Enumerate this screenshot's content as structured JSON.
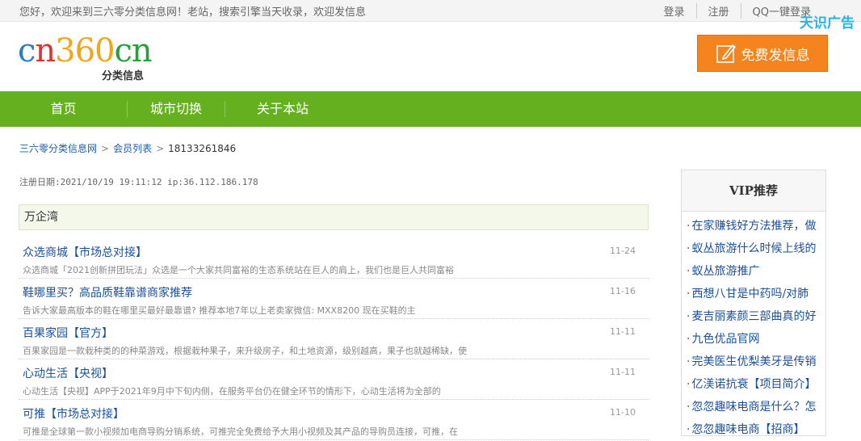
{
  "topbar": {
    "welcome": "您好，欢迎来到三六零分类信息网！老站，搜索引擎当天收录，欢迎发信息",
    "login": "登录",
    "register": "注册",
    "qq_login": "QQ一键登录",
    "ad_tag": "天识广告"
  },
  "logo": {
    "brand_1": "c",
    "brand_2": "n",
    "brand_3": "360",
    "brand_4": "cn",
    "sub": "分类信息"
  },
  "post_button": "免费发信息",
  "nav": [
    "首页",
    "城市切换",
    "关于本站"
  ],
  "breadcrumb": {
    "home": "三六零分类信息网",
    "members": "会员列表",
    "current": "18133261846"
  },
  "reginfo": "注册日期:2021/10/19 19:11:12 ip:36.112.186.178",
  "company": "万企湾",
  "entries": [
    {
      "title": "众选商城【市场总对接】",
      "desc": "众选商城「2021创新拼团玩法」众选是一个大家共同富裕的生态系统站在巨人的肩上，我们也是巨人共同富裕",
      "date": "11-24"
    },
    {
      "title": "鞋哪里买？高品质鞋靠谱商家推荐",
      "desc": "告诉大家最高版本的鞋在哪里买最好最靠谱? 推荐本地7年以上老卖家微信: MXX8200   现在买鞋的主",
      "date": "11-16"
    },
    {
      "title": "百果家园【官方】",
      "desc": "百果家园是一款栽种类的的种菜游戏，根据栽种果子，来升级房子，和土地资源，级别越高，果子也就越稀缺，使",
      "date": "11-11"
    },
    {
      "title": "心动生活【央视】",
      "desc": "心动生活【央视】APP于2021年9月中下旬内侧，在服务平台仍在健全环节的情形下，心动生活将为全部的",
      "date": "11-11"
    },
    {
      "title": "可推【市场总对接】",
      "desc": "可推是全球第一款小视频加电商导购分销系统，可推完全免费给予大用小视频及其产品的导购员连接，可推，在",
      "date": "11-10"
    }
  ],
  "vip": {
    "title": "VIP推荐",
    "items": [
      "在家赚钱好方法推荐，做",
      "蚁丛旅游什么时候上线的",
      "蚁丛旅游推广",
      "西想八甘是中药吗/对肺",
      "麦吉丽素颜三部曲真的好",
      "九色优品官网",
      "完美医生优梨美牙是传销",
      "亿渼诺抗衰【项目简介】",
      "忽忽趣味电商是什么？怎",
      "忽忽趣味电商【招商】"
    ]
  },
  "colors": {
    "nav_green": "#65b01f",
    "post_orange": "#f5841f",
    "link_blue": "#1a4f9c",
    "ad_blue": "#26b3ea"
  }
}
